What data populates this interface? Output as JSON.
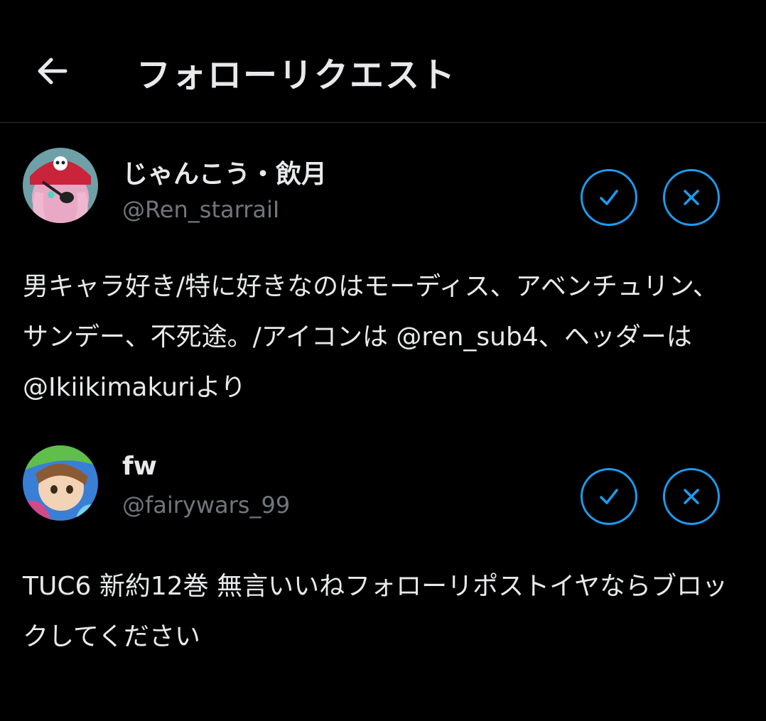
{
  "header": {
    "back_icon": "arrow-left-icon",
    "title": "フォローリクエスト"
  },
  "requests": [
    {
      "display_name": "じゃんこう・飲月",
      "handle": "@Ren_starraiI",
      "bio": "男キャラ好き/特に好きなのはモーディス、アベンチュリン、サンデー、不死途。/アイコンは @ren_sub4、ヘッダーは @Ikiikimakuriより",
      "accept_icon": "check-icon",
      "decline_icon": "x-icon"
    },
    {
      "display_name": "fw",
      "handle": "@fairywars_99",
      "bio": "TUC6 新約12巻 無言いいねフォローリポストイヤならブロックしてください",
      "accept_icon": "check-icon",
      "decline_icon": "x-icon"
    }
  ],
  "colors": {
    "background": "#000000",
    "text_primary": "#e7e9ea",
    "text_secondary": "#71767b",
    "accent": "#1d9bf0",
    "divider": "#2f3336"
  }
}
